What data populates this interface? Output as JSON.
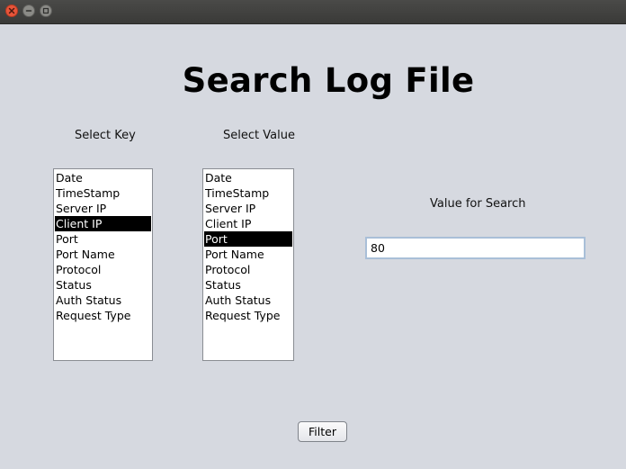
{
  "window": {
    "controls": [
      {
        "name": "close-icon"
      },
      {
        "name": "minimize-icon"
      },
      {
        "name": "maximize-icon"
      }
    ]
  },
  "header": {
    "title": "Search Log File"
  },
  "key_panel": {
    "label": "Select Key",
    "items": [
      "Date",
      "TimeStamp",
      "Server IP",
      "Client IP",
      "Port",
      "Port Name",
      "Protocol",
      "Status",
      "Auth Status",
      "Request Type"
    ],
    "selected": "Client IP"
  },
  "value_panel": {
    "label": "Select Value",
    "items": [
      "Date",
      "TimeStamp",
      "Server IP",
      "Client IP",
      "Port",
      "Port Name",
      "Protocol",
      "Status",
      "Auth Status",
      "Request Type"
    ],
    "selected": "Port"
  },
  "search": {
    "label": "Value for Search",
    "value": "80"
  },
  "actions": {
    "filter_label": "Filter"
  },
  "colors": {
    "background": "#d6d9e0",
    "selection": "#000000",
    "close_button": "#e8553a",
    "input_border": "#a9bfd8"
  }
}
